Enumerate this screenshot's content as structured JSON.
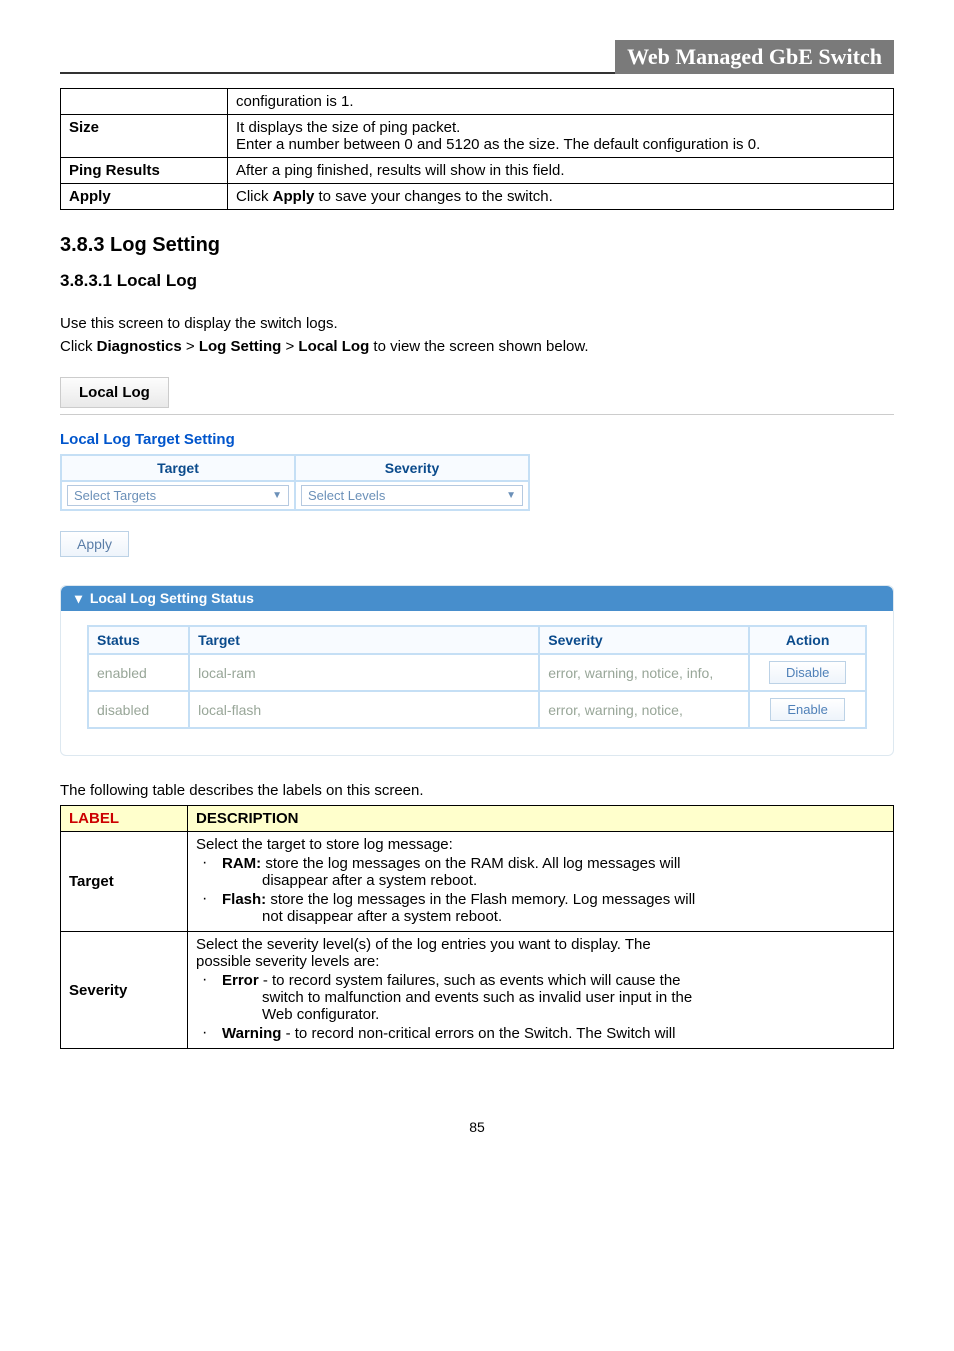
{
  "header": {
    "title": "Web Managed GbE Switch"
  },
  "top_table": {
    "rows": [
      {
        "label": "",
        "value": "configuration is 1."
      },
      {
        "label": "Size",
        "value_line1": "It displays the size of ping packet.",
        "value_line2": "Enter a number between 0 and 5120 as the size. The default configuration is 0."
      },
      {
        "label": "Ping Results",
        "value": "After a ping finished, results will show in this field."
      },
      {
        "label": "Apply",
        "value_prefix": "Click ",
        "value_bold": "Apply",
        "value_suffix": " to save your changes to the switch."
      }
    ]
  },
  "section": {
    "h2": "3.8.3 Log Setting",
    "h3": "3.8.3.1 Local Log",
    "intro1": "Use this screen to display the switch logs.",
    "intro2_prefix": "Click ",
    "intro2_b1": "Diagnostics",
    "intro2_sep1": " > ",
    "intro2_b2": "Log Setting",
    "intro2_sep2": " > ",
    "intro2_b3": "Local Log",
    "intro2_suffix": " to view the screen shown below.",
    "tab_label": "Local Log"
  },
  "form": {
    "title": "Local Log Target Setting",
    "headers": {
      "target": "Target",
      "severity": "Severity"
    },
    "select_targets": "Select Targets",
    "select_levels": "Select Levels",
    "apply_label": "Apply"
  },
  "status_panel": {
    "caret": "▾",
    "title": "Local Log Setting Status",
    "headers": {
      "status": "Status",
      "target": "Target",
      "severity": "Severity",
      "action": "Action"
    },
    "rows": [
      {
        "status": "enabled",
        "target": "local-ram",
        "severity": "error, warning, notice, info,",
        "action": "Disable"
      },
      {
        "status": "disabled",
        "target": "local-flash",
        "severity": "error, warning, notice,",
        "action": "Enable"
      }
    ]
  },
  "desc_caption": "The following table describes the labels on this screen.",
  "desc_table": {
    "headers": {
      "label": "LABEL",
      "desc": "DESCRIPTION"
    },
    "target": {
      "label": "Target",
      "intro": "Select the target to store log message:",
      "ram_bold": "RAM:",
      "ram_text": " store the log messages on the RAM disk. All log messages will",
      "ram_cont": "disappear after a system reboot.",
      "flash_bold": "Flash:",
      "flash_text": " store the log messages in the Flash memory. Log messages will",
      "flash_cont": "not disappear after a system reboot."
    },
    "severity": {
      "label": "Severity",
      "intro1": "Select the severity level(s) of the log entries you want to display. The",
      "intro2": "possible severity levels are:",
      "error_bold": "Error",
      "error_text": " - to record system failures, such as events which will cause the",
      "error_cont1": "switch to malfunction and events such as invalid user input in the",
      "error_cont2": "Web configurator.",
      "warning_bold": "Warning",
      "warning_text": " - to record non-critical errors on the Switch. The Switch will"
    }
  },
  "page_number": "85"
}
